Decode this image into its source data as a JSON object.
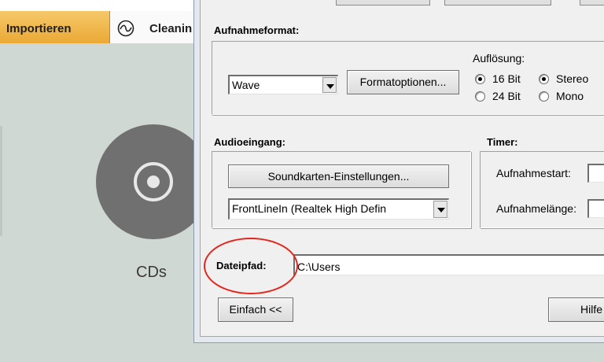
{
  "background_app": {
    "tab_import": "Importieren",
    "tab_cleaning": "Cleanin",
    "cd_label": "CDs"
  },
  "dialog": {
    "recording_format": {
      "heading": "Aufnahmeformat:",
      "format_value": "Wave",
      "format_options_button": "Formatoptionen...",
      "resolution_label": "Auflösung:",
      "bit16": "16 Bit",
      "bit24": "24 Bit",
      "stereo": "Stereo",
      "mono": "Mono",
      "selected_bits": "16 Bit",
      "selected_channels": "Stereo"
    },
    "audio_input": {
      "heading": "Audioeingang:",
      "soundcard_button": "Soundkarten-Einstellungen...",
      "device_value": "FrontLineIn (Realtek High Defin"
    },
    "timer": {
      "heading": "Timer:",
      "start_label": "Aufnahmestart:",
      "length_label": "Aufnahmelänge:"
    },
    "filepath": {
      "label": "Dateipfad:",
      "value": "C:\\Users"
    },
    "simple_button": "Einfach <<",
    "help_button": "Hilfe"
  },
  "colors": {
    "import_tab": "#eaa934",
    "highlight": "#e3271c",
    "cd_disc": "#707070"
  }
}
